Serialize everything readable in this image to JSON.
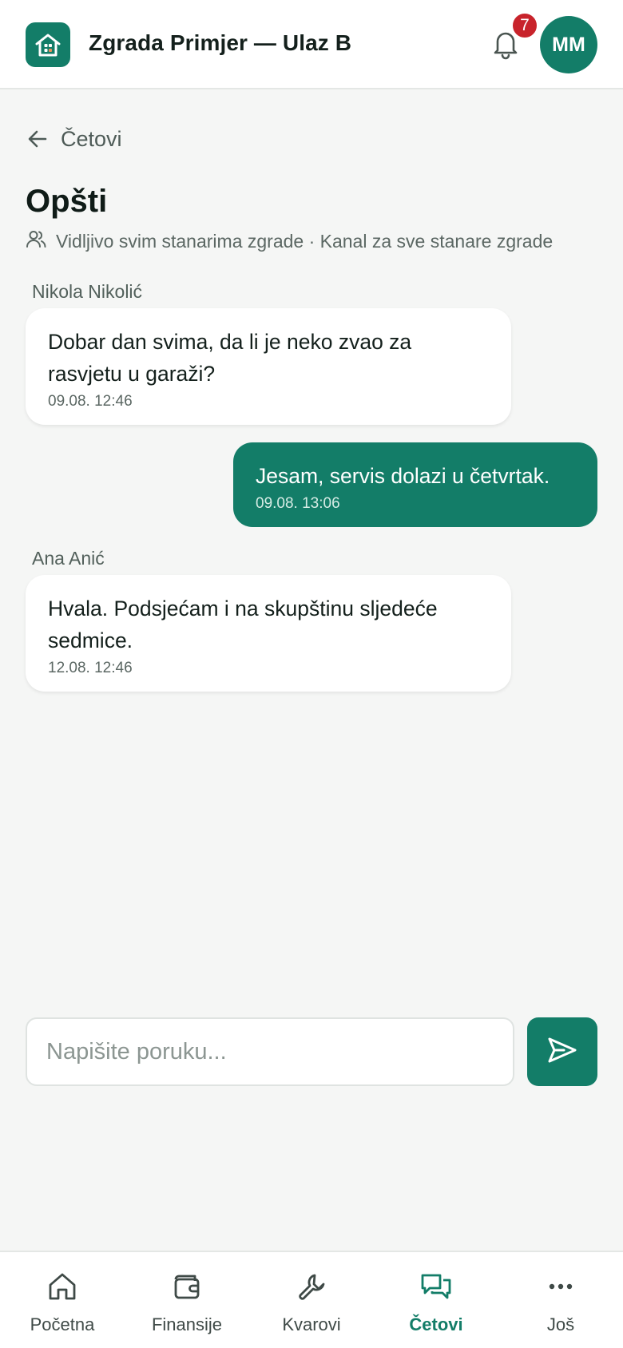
{
  "header": {
    "app_title": "Zgrada Primjer — Ulaz B",
    "notifications_count": "7",
    "avatar_initials": "MM",
    "logo_icon": "building-icon",
    "bell_icon": "bell-icon"
  },
  "back_link": {
    "label": "Četovi",
    "icon": "arrow-left-icon"
  },
  "channel": {
    "title": "Opšti",
    "subtitle": "Vidljivo svim stanarima zgrade · Kanal za sve stanare zgrade",
    "subtitle_icon": "users-icon"
  },
  "messages": [
    {
      "sender": "Nikola Nikolić",
      "text": "Dobar dan svima, da li je neko zvao za rasvjetu u garaži?",
      "time": "09.08. 12:46",
      "outgoing": false
    },
    {
      "sender": "",
      "text": "Jesam, servis dolazi u četvrtak.",
      "time": "09.08. 13:06",
      "outgoing": true
    },
    {
      "sender": "Ana Anić",
      "text": "Hvala. Podsjećam i na skupštinu sljedeće sedmice.",
      "time": "12.08. 12:46",
      "outgoing": false
    }
  ],
  "composer": {
    "placeholder": "Napišite poruku...",
    "value": "",
    "send_icon": "send-icon"
  },
  "nav": {
    "items": [
      {
        "label": "Početna",
        "icon": "home-icon",
        "active": false
      },
      {
        "label": "Finansije",
        "icon": "wallet-icon",
        "active": false
      },
      {
        "label": "Kvarovi",
        "icon": "wrench-icon",
        "active": false
      },
      {
        "label": "Četovi",
        "icon": "chat-icon",
        "active": true
      },
      {
        "label": "Još",
        "icon": "more-icon",
        "active": false
      }
    ]
  },
  "colors": {
    "brand": "#137d68",
    "badge": "#c8232b",
    "background": "#f5f6f5"
  }
}
